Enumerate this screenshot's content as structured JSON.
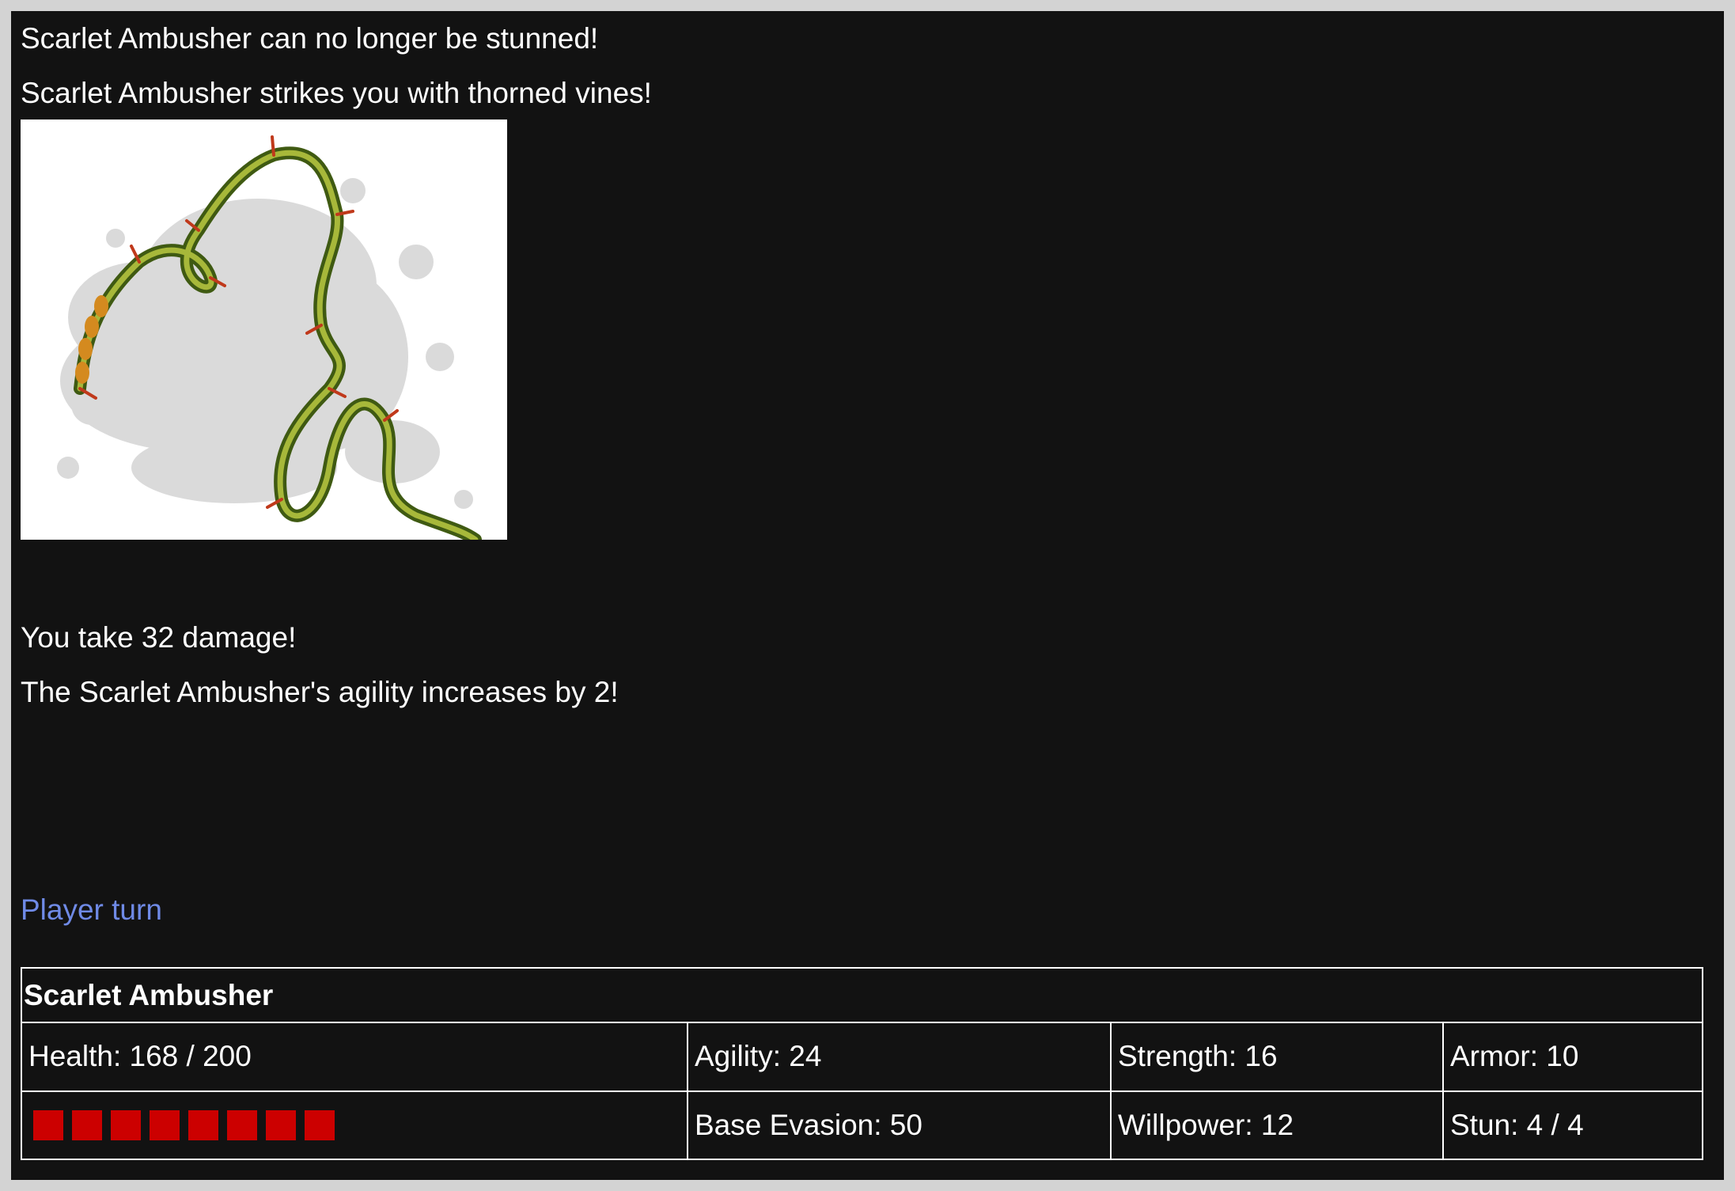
{
  "log": {
    "messages": [
      "Scarlet Ambusher can no longer be stunned!",
      "Scarlet Ambusher strikes you with thorned vines!",
      "You take 32 damage!",
      "The Scarlet Ambusher's agility increases by 2!"
    ],
    "image": {
      "icon": "thorned-vine-illustration"
    },
    "turn_label": "Player turn",
    "turn_color": "#6f8ae6"
  },
  "enemy": {
    "name": "Scarlet Ambusher",
    "health": "Health: 168 / 200",
    "health_value": 168,
    "health_max": 200,
    "health_blocks": 8,
    "health_block_color": "#cc0000",
    "agility": "Agility: 24",
    "strength": "Strength: 16",
    "armor": "Armor: 10",
    "base_evasion": "Base Evasion: 50",
    "willpower": "Willpower: 12",
    "stun": "Stun: 4 / 4"
  },
  "colors": {
    "background": "#121212",
    "frame": "#d3d3d3",
    "text": "#ffffff"
  }
}
